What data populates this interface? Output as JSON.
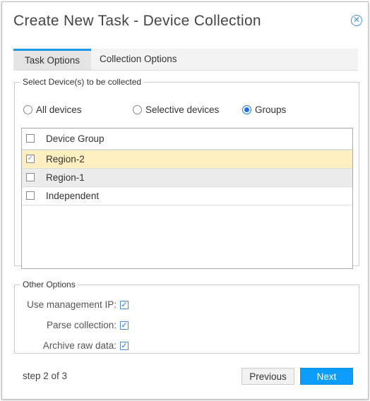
{
  "dialog": {
    "title": "Create New Task - Device Collection",
    "close_icon": "circle-x"
  },
  "tabs": [
    {
      "label": "Task Options",
      "active": true
    },
    {
      "label": "Collection Options",
      "active": false
    }
  ],
  "select_devices": {
    "legend": "Select Device(s) to be collected",
    "radios": [
      {
        "label": "All devices",
        "selected": false
      },
      {
        "label": "Selective devices",
        "selected": false
      },
      {
        "label": "Groups",
        "selected": true
      }
    ],
    "table": {
      "header": "Device Group",
      "rows": [
        {
          "name": "Region-2",
          "checked": true
        },
        {
          "name": "Region-1",
          "checked": false
        },
        {
          "name": "Independent",
          "checked": false
        }
      ]
    }
  },
  "other_options": {
    "legend": "Other Options",
    "options": [
      {
        "label": "Use management IP:",
        "checked": true
      },
      {
        "label": "Parse collection:",
        "checked": true
      },
      {
        "label": "Archive raw data:",
        "checked": true
      }
    ]
  },
  "footer": {
    "step": "step 2 of 3",
    "previous": "Previous",
    "next": "Next"
  }
}
